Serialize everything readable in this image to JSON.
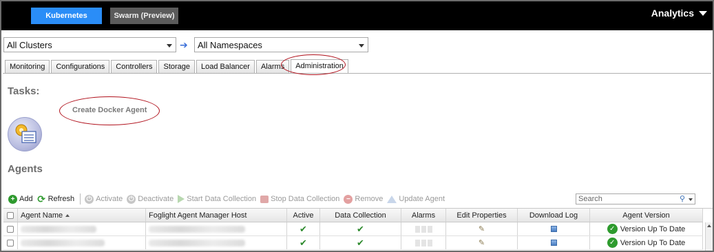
{
  "topbar": {
    "kubernetes_label": "Kubernetes",
    "swarm_label": "Swarm (Preview)",
    "analytics_label": "Analytics"
  },
  "selectors": {
    "clusters_value": "All Clusters",
    "namespaces_value": "All Namespaces"
  },
  "tabs": [
    {
      "label": "Monitoring"
    },
    {
      "label": "Configurations"
    },
    {
      "label": "Controllers"
    },
    {
      "label": "Storage"
    },
    {
      "label": "Load Balancer"
    },
    {
      "label": "Alarms"
    },
    {
      "label": "Administration",
      "active": true
    }
  ],
  "tasks": {
    "heading": "Tasks:",
    "create_agent_label": "Create Docker Agent"
  },
  "agents": {
    "heading": "Agents",
    "toolbar": {
      "add": "Add",
      "refresh": "Refresh",
      "activate": "Activate",
      "deactivate": "Deactivate",
      "start_collection": "Start Data Collection",
      "stop_collection": "Stop Data Collection",
      "remove": "Remove",
      "update_agent": "Update Agent"
    },
    "search_placeholder": "Search",
    "columns": {
      "agent_name": "Agent Name",
      "host": "Foglight Agent Manager Host",
      "active": "Active",
      "data_collection": "Data Collection",
      "alarms": "Alarms",
      "edit_properties": "Edit Properties",
      "download_log": "Download Log",
      "agent_version": "Agent Version"
    },
    "rows": [
      {
        "version": "Version Up To Date"
      },
      {
        "version": "Version Up To Date"
      }
    ]
  },
  "colors": {
    "topbar_bg": "#000000",
    "kubernetes_btn": "#2a8df7",
    "highlight_oval": "#b0101b"
  }
}
